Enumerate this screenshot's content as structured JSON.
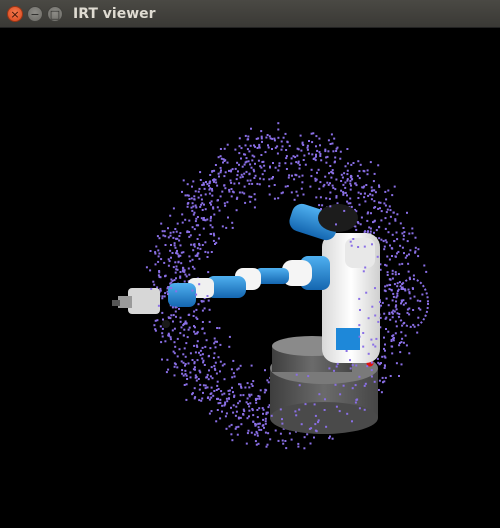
{
  "window": {
    "title": "IRT viewer",
    "controls": {
      "close_glyph": "×",
      "minimize_glyph": "−",
      "maximize_glyph": "□"
    }
  },
  "colors": {
    "titlebar": "#3c3b37",
    "background": "#000000",
    "point_cloud": "#8a6fe6",
    "robot_white": "#f2f2f2",
    "robot_blue": "#1e88d9",
    "base_gray": "#5a5a5a",
    "indicator_red": "#e01010"
  }
}
